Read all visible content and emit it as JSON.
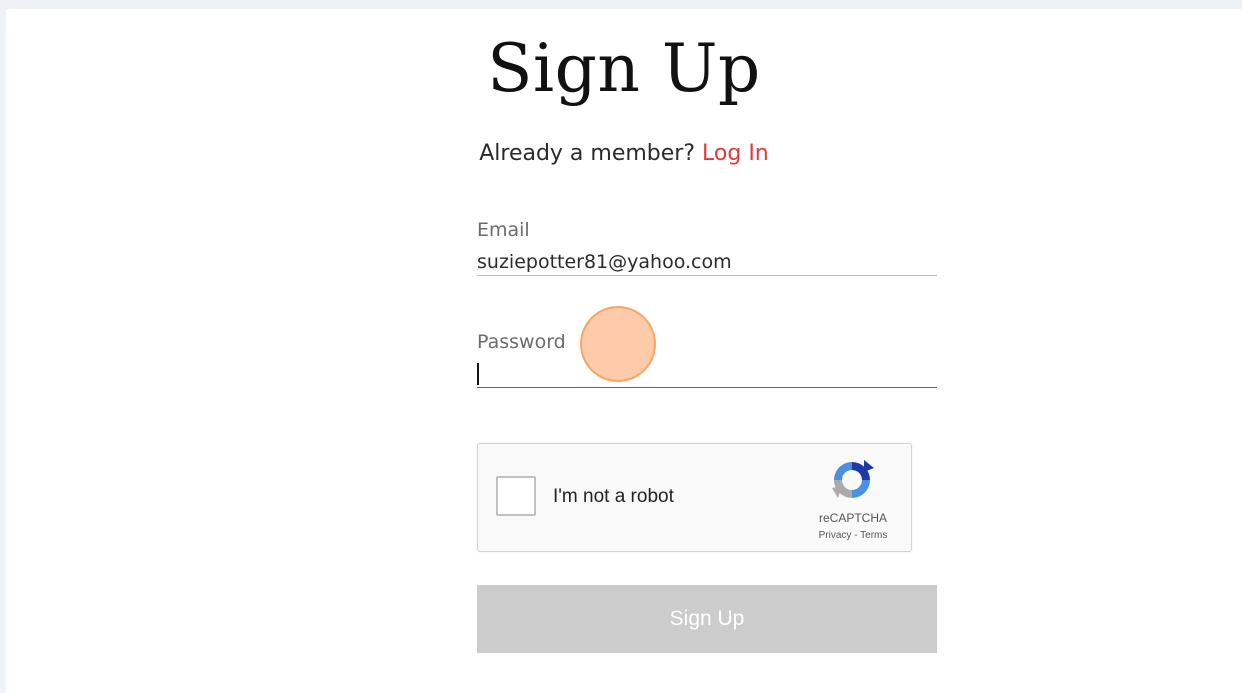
{
  "heading": "Sign Up",
  "member_prompt": {
    "text": "Already a member?",
    "login_link": "Log In"
  },
  "email": {
    "label": "Email",
    "value": "suziepotter81@yahoo.com"
  },
  "password": {
    "label": "Password",
    "value": ""
  },
  "recaptcha": {
    "checkbox_label": "I'm not a robot",
    "brand": "reCAPTCHA",
    "privacy_link": "Privacy",
    "separator": " - ",
    "terms_link": "Terms",
    "icon": "recaptcha-logo-icon"
  },
  "submit_button": "Sign Up",
  "colors": {
    "accent_link": "#e2383d",
    "active_underline": "#c43a3a",
    "button_disabled": "#cccccc",
    "click_marker": "#fcba8c"
  }
}
